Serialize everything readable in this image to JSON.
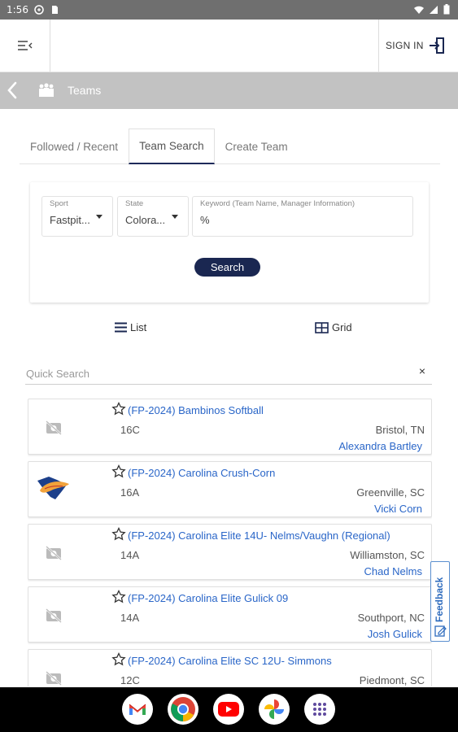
{
  "status_bar": {
    "time": "1:56"
  },
  "header": {
    "signin_label": "SIGN IN"
  },
  "breadcrumb": {
    "title": "Teams"
  },
  "tabs": [
    {
      "label": "Followed / Recent",
      "active": false
    },
    {
      "label": "Team Search",
      "active": true
    },
    {
      "label": "Create Team",
      "active": false
    }
  ],
  "search": {
    "sport_label": "Sport",
    "sport_value": "Fastpit...",
    "state_label": "State",
    "state_value": "Colora...",
    "keyword_label": "Keyword (Team Name, Manager Information)",
    "keyword_value": "%",
    "button_label": "Search"
  },
  "view": {
    "list_label": "List",
    "grid_label": "Grid"
  },
  "quick_search": {
    "placeholder": "Quick Search",
    "clear": "×"
  },
  "teams": [
    {
      "name": "(FP-2024) Bambinos Softball",
      "age": "16C",
      "location": "Bristol, TN",
      "manager": "Alexandra Bartley",
      "has_logo": false
    },
    {
      "name": "(FP-2024) Carolina Crush-Corn",
      "age": "16A",
      "location": "Greenville, SC",
      "manager": "Vicki Corn",
      "has_logo": true
    },
    {
      "name": "(FP-2024) Carolina Elite 14U- Nelms/Vaughn (Regional)",
      "age": "14A",
      "location": "Williamston, SC",
      "manager": "Chad Nelms",
      "has_logo": false
    },
    {
      "name": "(FP-2024) Carolina Elite Gulick 09",
      "age": "14A",
      "location": "Southport, NC",
      "manager": "Josh Gulick",
      "has_logo": false
    },
    {
      "name": "(FP-2024) Carolina Elite SC 12U- Simmons",
      "age": "12C",
      "location": "Piedmont, SC",
      "manager": "",
      "has_logo": false
    }
  ],
  "feedback": {
    "label": "Feedback"
  },
  "colors": {
    "navy": "#1a2751",
    "link_blue": "#2a66c8",
    "crumb_gray": "#c2c2c2",
    "status_gray": "#6f6f6f"
  }
}
